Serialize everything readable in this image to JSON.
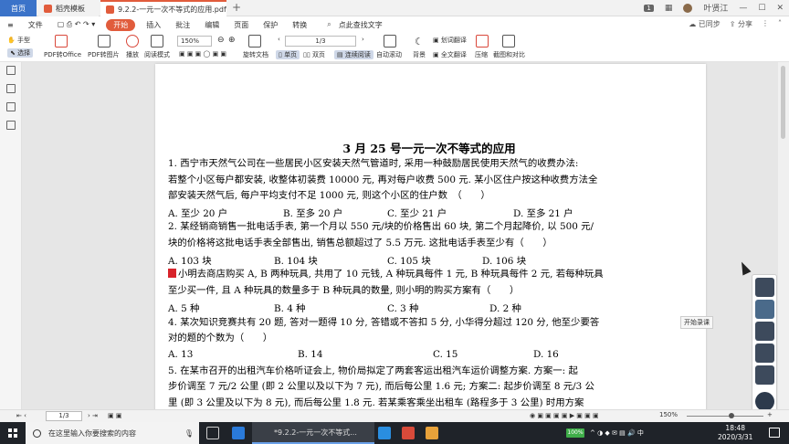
{
  "tabs": {
    "home": "首页",
    "wps": "稻壳模板",
    "pdf": "9.2.2-一元一次不等式的应用.pdf"
  },
  "window": {
    "badge": "1",
    "user": "叶贤江"
  },
  "menu": {
    "file": "文件",
    "start": "开始",
    "insert": "插入",
    "annotate": "批注",
    "edit": "编辑",
    "page": "页面",
    "protect": "保护",
    "convert": "转换",
    "search": "点此查找文字",
    "sync": "已同步",
    "share": "分享"
  },
  "toolbar": {
    "hand": "手型",
    "select": "选择",
    "pdf_to_office": "PDF转Office",
    "pdf_to_image": "PDF转图片",
    "play": "播放",
    "read_mode": "阅读模式",
    "zoom_value": "150%",
    "page_value": "1/3",
    "rotate": "旋转文档",
    "single": "单页",
    "double": "双页",
    "continuous": "连续阅读",
    "auto_scroll": "自动滚动",
    "background": "背景",
    "word_translate": "划词翻译",
    "full_translate": "全文翻译",
    "compress": "压缩",
    "screenshot": "截图和对比"
  },
  "document": {
    "title": "3 月 25 号一元一次不等式的应用",
    "lines": [
      "1. 西宁市天然气公司在一些居民小区安装天然气管道时, 采用一种鼓励居民使用天然气的收费办法:",
      "若整个小区每户都安装, 收整体初装费 10000 元, 再对每户收费 500 元. 某小区住户按这种收费方法全",
      "部安装天然气后, 每户平均支付不足 1000 元, 则这个小区的住户数　（　　）",
      "2. 某经销商销售一批电话手表, 第一个月以 550 元/块的价格售出 60 块, 第二个月起降价, 以 500 元/",
      "块的价格将这批电话手表全部售出, 销售总额超过了 5.5 万元. 这批电话手表至少有（　　）",
      "小明去商店购买 A, B 两种玩具, 共用了 10 元钱, A 种玩具每件 1 元, B 种玩具每件 2 元, 若每种玩具",
      "至少买一件, 且 A 种玩具的数量多于 B 种玩具的数量, 则小明的购买方案有（　　）",
      "4. 某次知识竞赛共有 20 题, 答对一题得 10 分, 答错或不答扣 5 分, 小华得分超过 120 分, 他至少要答",
      "对的题的个数为（　　）",
      "5. 在某市召开的出租汽车价格听证会上, 物价局拟定了两套客运出租汽车运价调整方案. 方案一: 起",
      "步价调至 7 元/2 公里 (即 2 公里以及以下为 7 元), 而后每公里 1.6 元; 方案二: 起步价调至 8 元/3 公",
      "里 (即 3 公里及以下为 8 元), 而后每公里 1.8 元. 若某乘客乘坐出租车 (路程多于 3 公里) 时用方案"
    ],
    "q1_options": [
      "A. 至少 20 户",
      "B. 至多 20 户",
      "C. 至少 21 户",
      "D. 至多 21 户"
    ],
    "q2_options": [
      "A. 103 块",
      "B. 104 块",
      "C. 105 块",
      "D. 106 块"
    ],
    "q3_options": [
      "A. 5 种",
      "B. 4 种",
      "C. 3 种",
      "D. 2 种"
    ],
    "q4_options": [
      "A. 13",
      "B. 14",
      "C. 15",
      "D. 16"
    ]
  },
  "tooltip": "开始录课",
  "statusbar": {
    "page": "1/3",
    "zoom": "150%"
  },
  "taskbar": {
    "search_placeholder": "在这里输入你要搜索的内容",
    "ie_text": "*9.2.2-一元一次不等式...",
    "battery": "100%",
    "time": "18:48",
    "date": "2020/3/31"
  },
  "colors": {
    "accent": "#3b73c9",
    "start_button": "#e15c3c",
    "question_marker": "#d8232a"
  }
}
